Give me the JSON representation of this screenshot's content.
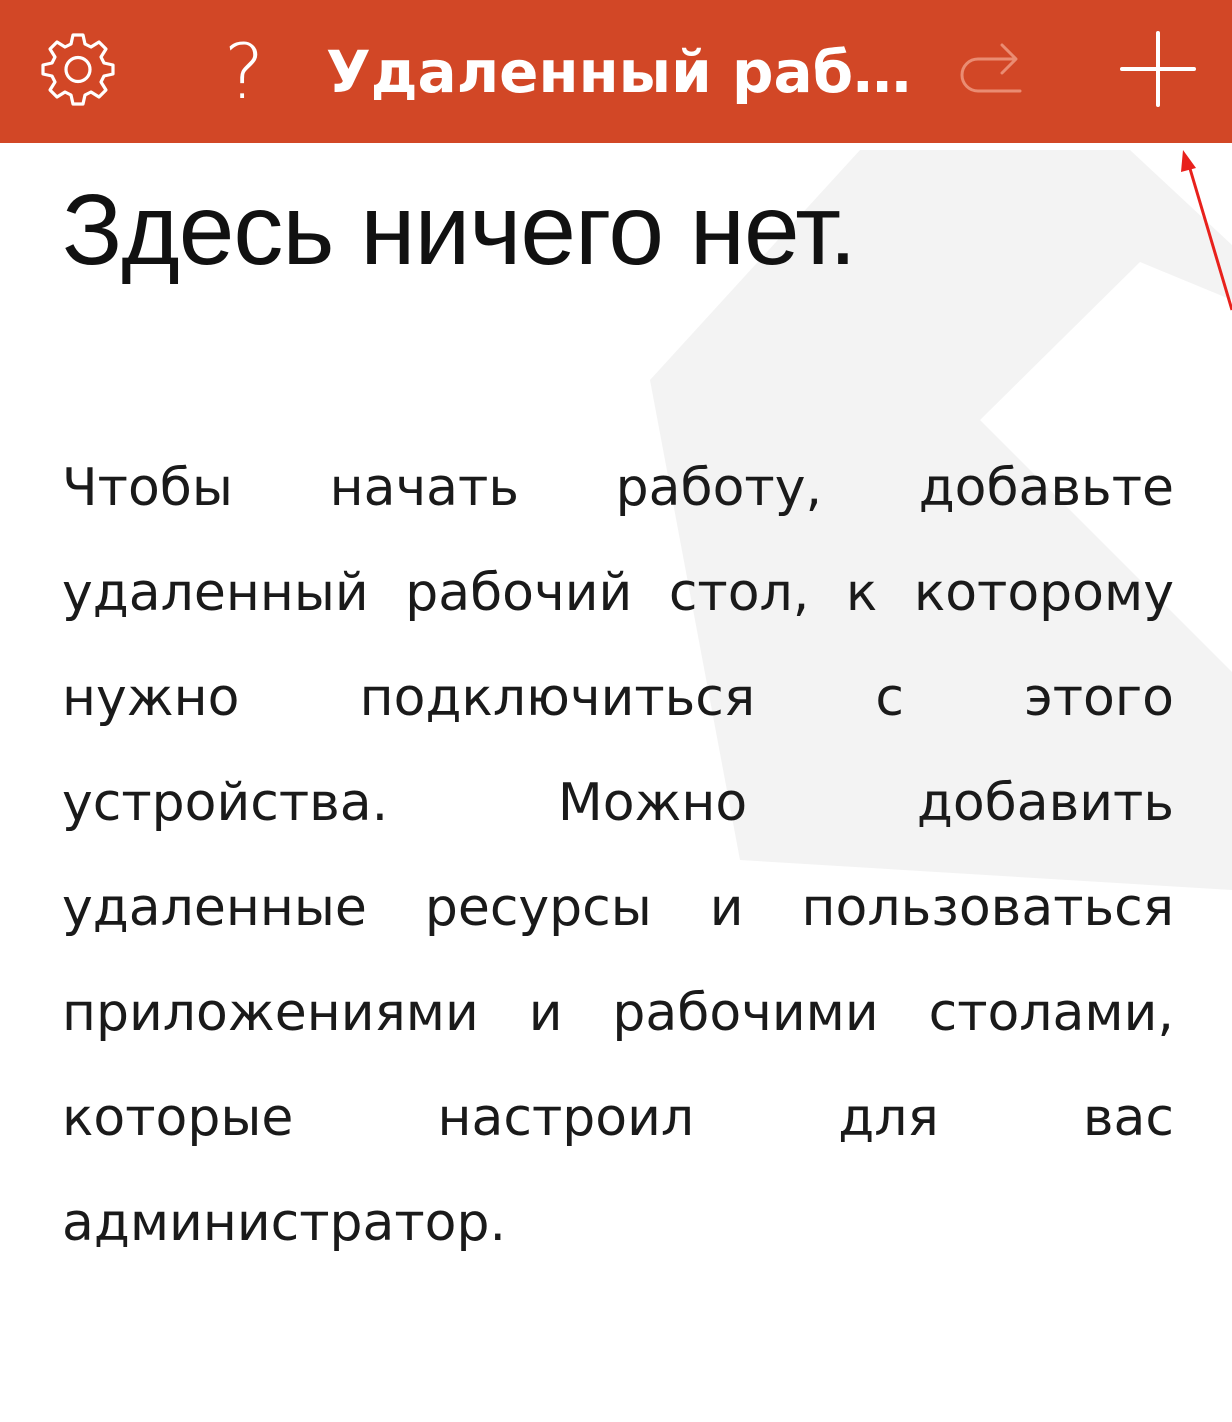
{
  "topbar": {
    "title": "Удаленный раб…",
    "background": "#d24726",
    "icons": {
      "settings": "gear-icon",
      "help": "question-icon",
      "refresh": "refresh-icon",
      "add": "plus-icon"
    },
    "help_glyph": "?"
  },
  "empty_state": {
    "heading": "Здесь ничего нет.",
    "lines": [
      [
        "Чтобы",
        "начать",
        "работу,",
        "добавьте"
      ],
      [
        "удаленный",
        "рабочий",
        "стол,",
        "к",
        "которому"
      ],
      [
        "нужно",
        "подключиться",
        "с",
        "этого"
      ],
      [
        "устройства.",
        "Можно",
        "добавить"
      ],
      [
        "удаленные",
        "ресурсы",
        "и",
        "пользоваться"
      ],
      [
        "приложениями",
        "и",
        "рабочими",
        "столами,"
      ],
      [
        "которые",
        "настроил",
        "для",
        "вас"
      ],
      [
        "администратор."
      ]
    ]
  },
  "annotation": {
    "arrow_color": "#e8211c",
    "target": "add-button"
  }
}
